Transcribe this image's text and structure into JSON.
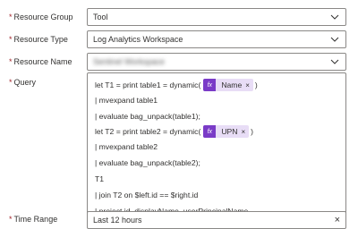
{
  "resource_group": {
    "label": "Resource Group",
    "value": "Tool"
  },
  "resource_type": {
    "label": "Resource Type",
    "value": "Log Analytics Workspace"
  },
  "resource_name": {
    "label": "Resource Name",
    "value": "Sentinel Workspace"
  },
  "query": {
    "label": "Query",
    "lines": [
      "let T1 = print table1 = dynamic(",
      "| mvexpand table1",
      "| evaluate bag_unpack(table1);",
      "let T2 = print table2 = dynamic(",
      "| mvexpand table2",
      "| evaluate bag_unpack(table2);",
      "T1",
      "| join T2 on $left.id == $right.id",
      "| project id, displayName, userPrincipalName"
    ],
    "token1": {
      "icon": "fx",
      "name": "Name",
      "close": "×",
      "after": ")"
    },
    "token2": {
      "icon": "fx",
      "name": "UPN",
      "close": "×",
      "after": ")"
    }
  },
  "time_range": {
    "label": "Time Range",
    "value": "Last 12 hours",
    "clear": "×"
  },
  "required_marker": "*",
  "colors": {
    "token_icon": "#7a3bc7",
    "token_bg": "#e8ddf6",
    "required": "#a4262c",
    "border": "#8a8886"
  }
}
